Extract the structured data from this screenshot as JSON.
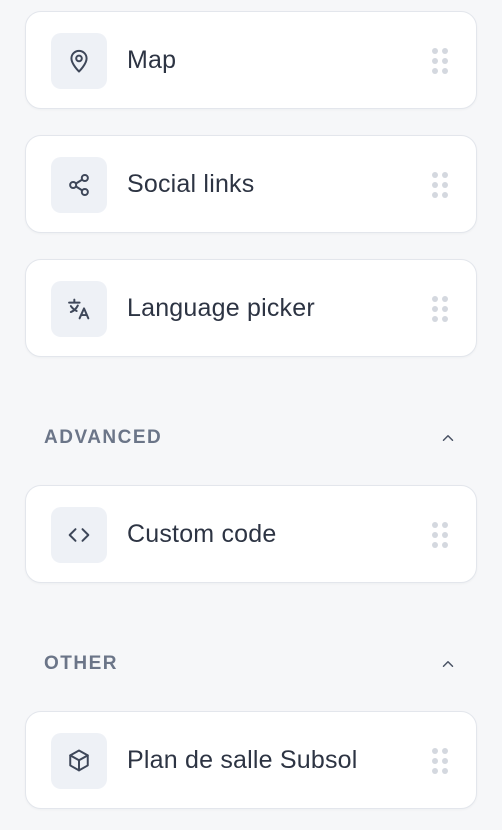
{
  "blocks_top": [
    {
      "label": "Map",
      "icon": "map-pin-icon"
    },
    {
      "label": "Social links",
      "icon": "share-icon"
    },
    {
      "label": "Language picker",
      "icon": "translate-icon"
    }
  ],
  "sections": {
    "advanced": {
      "title": "ADVANCED",
      "collapse_icon": "chevron-up-icon",
      "items": [
        {
          "label": "Custom code",
          "icon": "code-icon"
        }
      ]
    },
    "other": {
      "title": "OTHER",
      "collapse_icon": "chevron-up-icon",
      "items": [
        {
          "label": "Plan de salle Subsol",
          "icon": "cube-icon"
        }
      ]
    }
  },
  "colors": {
    "background": "#f6f7f9",
    "card": "#ffffff",
    "icon_bg": "#eef1f6",
    "text": "#2d3443",
    "section_text": "#6b7588",
    "handle_dots": "#d4d8df"
  }
}
